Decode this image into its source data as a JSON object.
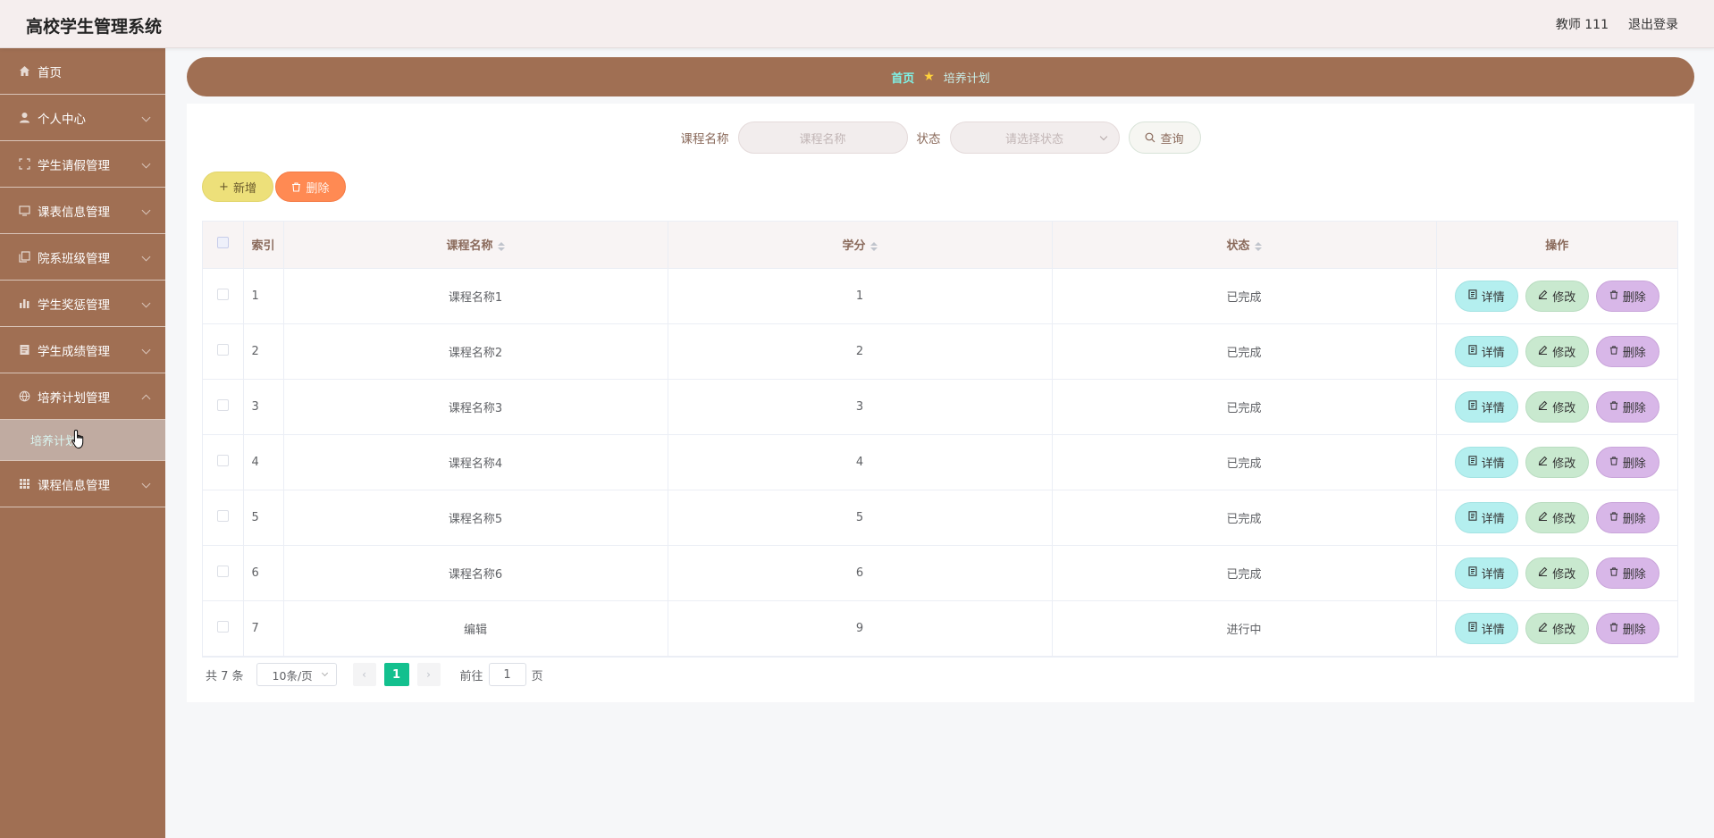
{
  "header": {
    "title": "高校学生管理系统",
    "user": "教师 111",
    "logout": "退出登录"
  },
  "sidebar": {
    "items": [
      {
        "label": "首页",
        "icon": "home-icon"
      },
      {
        "label": "个人中心",
        "icon": "user-icon"
      },
      {
        "label": "学生请假管理",
        "icon": "expand-icon"
      },
      {
        "label": "课表信息管理",
        "icon": "monitor-icon"
      },
      {
        "label": "院系班级管理",
        "icon": "copy-icon"
      },
      {
        "label": "学生奖惩管理",
        "icon": "bar-chart-icon"
      },
      {
        "label": "学生成绩管理",
        "icon": "document-icon"
      },
      {
        "label": "培养计划管理",
        "icon": "globe-icon"
      },
      {
        "label": "课程信息管理",
        "icon": "grid-icon"
      }
    ],
    "sub_item": "培养计划"
  },
  "breadcrumb": {
    "home": "首页",
    "current": "培养计划"
  },
  "search": {
    "course_label": "课程名称",
    "course_placeholder": "课程名称",
    "status_label": "状态",
    "status_placeholder": "请选择状态",
    "button": "查询"
  },
  "actions": {
    "add": "新增",
    "delete": "删除"
  },
  "table": {
    "headers": {
      "index": "索引",
      "name": "课程名称",
      "credit": "学分",
      "status": "状态",
      "ops": "操作"
    },
    "rows": [
      {
        "index": "1",
        "name": "课程名称1",
        "credit": "1",
        "status": "已完成"
      },
      {
        "index": "2",
        "name": "课程名称2",
        "credit": "2",
        "status": "已完成"
      },
      {
        "index": "3",
        "name": "课程名称3",
        "credit": "3",
        "status": "已完成"
      },
      {
        "index": "4",
        "name": "课程名称4",
        "credit": "4",
        "status": "已完成"
      },
      {
        "index": "5",
        "name": "课程名称5",
        "credit": "5",
        "status": "已完成"
      },
      {
        "index": "6",
        "name": "课程名称6",
        "credit": "6",
        "status": "已完成"
      },
      {
        "index": "7",
        "name": "编辑",
        "credit": "9",
        "status": "进行中"
      }
    ],
    "op_labels": {
      "detail": "详情",
      "edit": "修改",
      "delete": "删除"
    }
  },
  "pagination": {
    "total": "共 7 条",
    "page_size": "10条/页",
    "current": "1",
    "goto_prefix": "前往",
    "goto_value": "1",
    "goto_suffix": "页"
  },
  "colors": {
    "sidebar": "#a06f53",
    "accent_teal": "#13c08e",
    "detail": "#b4efef",
    "edit": "#c9e9cf",
    "delete_op": "#d8b7e8",
    "add": "#ede07a",
    "delete": "#ff8a53"
  }
}
